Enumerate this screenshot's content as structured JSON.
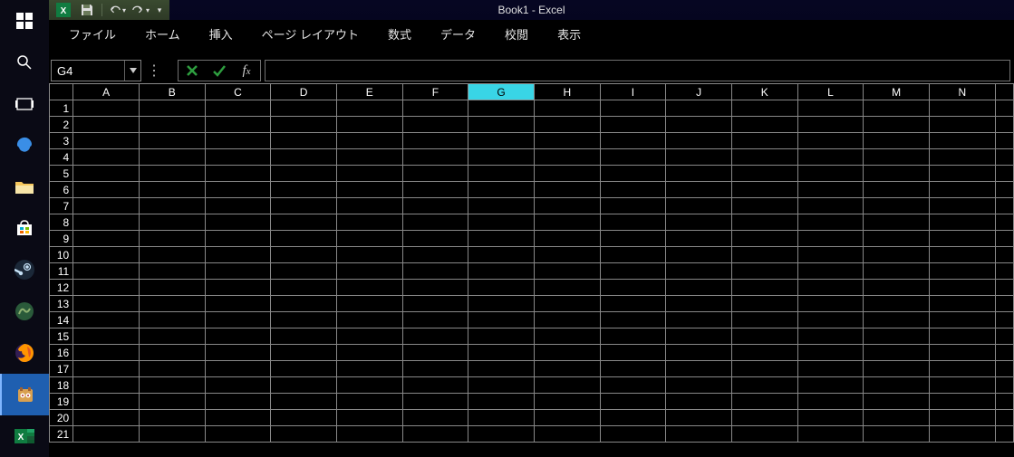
{
  "title": "Book1 - Excel",
  "qat_icons": [
    "excel-icon",
    "save-icon",
    "undo-icon",
    "redo-icon"
  ],
  "ribbon_tabs": [
    "ファイル",
    "ホーム",
    "挿入",
    "ページ レイアウト",
    "数式",
    "データ",
    "校閲",
    "表示"
  ],
  "namebox_value": "G4",
  "formula_value": "",
  "columns": [
    "A",
    "B",
    "C",
    "D",
    "E",
    "F",
    "G",
    "H",
    "I",
    "J",
    "K",
    "L",
    "M",
    "N"
  ],
  "selected_column": "G",
  "rows": [
    "1",
    "2",
    "3",
    "4",
    "5",
    "6",
    "7",
    "8",
    "9",
    "10",
    "11",
    "12",
    "13",
    "14",
    "15",
    "16",
    "17",
    "18",
    "19",
    "20",
    "21"
  ],
  "taskbar_items": [
    {
      "name": "start-icon"
    },
    {
      "name": "search-icon"
    },
    {
      "name": "taskview-icon"
    },
    {
      "name": "edge-icon"
    },
    {
      "name": "explorer-icon"
    },
    {
      "name": "store-icon"
    },
    {
      "name": "steam-icon"
    },
    {
      "name": "app-icon"
    },
    {
      "name": "firefox-icon"
    },
    {
      "name": "app2-icon",
      "active": true
    },
    {
      "name": "excel-taskbar-icon"
    }
  ]
}
